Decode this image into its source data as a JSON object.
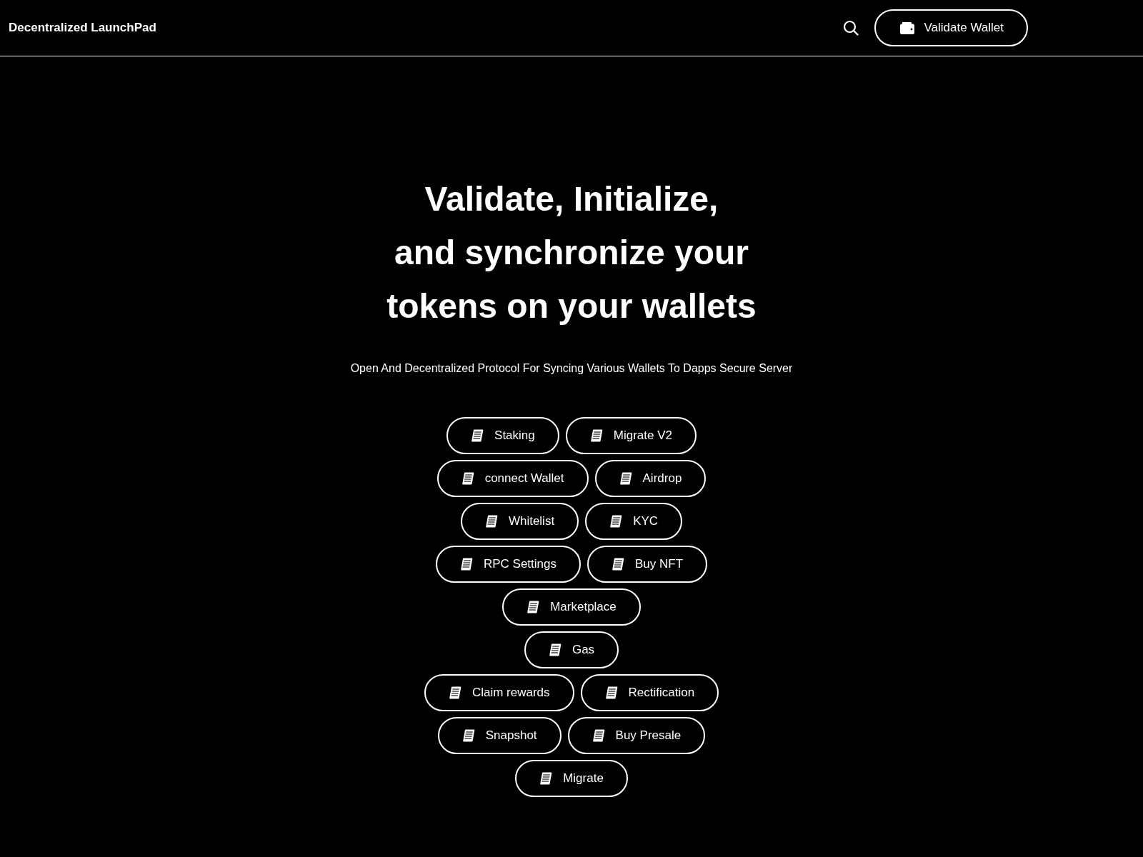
{
  "header": {
    "title": "Decentralized LaunchPad",
    "wallet_button": "Validate Wallet"
  },
  "hero": {
    "heading_lines": [
      "Validate, Initialize,",
      "and synchronize your",
      "tokens on your wallets"
    ],
    "subtitle": "Open And Decentralized Protocol For Syncing Various Wallets To Dapps Secure Server"
  },
  "action_rows": [
    {
      "buttons": [
        "Staking",
        "Migrate V2"
      ]
    },
    {
      "buttons": [
        "connect Wallet",
        "Airdrop"
      ]
    },
    {
      "buttons": [
        "Whitelist",
        "KYC"
      ]
    },
    {
      "buttons": [
        "RPC Settings",
        "Buy NFT"
      ]
    },
    {
      "buttons": [
        "Marketplace"
      ]
    },
    {
      "buttons": [
        "Gas"
      ]
    },
    {
      "buttons": [
        "Claim rewards",
        "Rectification"
      ]
    },
    {
      "buttons": [
        "Snapshot",
        "Buy Presale"
      ]
    },
    {
      "buttons": [
        "Migrate"
      ]
    }
  ]
}
